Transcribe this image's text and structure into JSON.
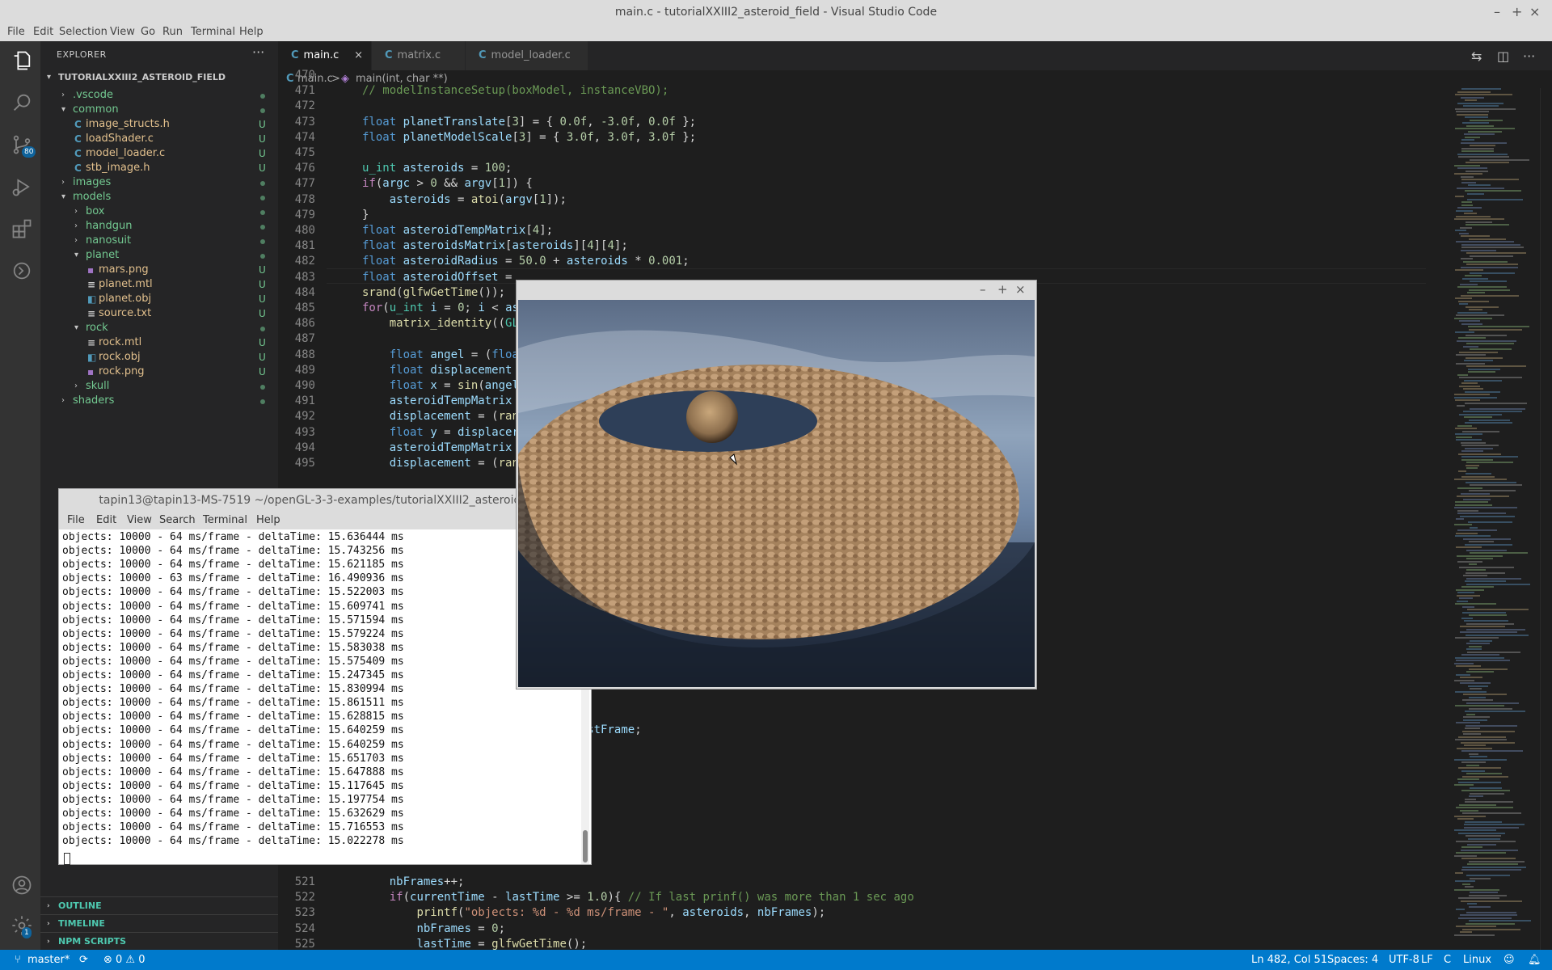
{
  "window": {
    "title": "main.c - tutorialXXIII2_asteroid_field - Visual Studio Code",
    "controls": [
      "–",
      "+",
      "×"
    ]
  },
  "menu": [
    "File",
    "Edit",
    "Selection",
    "View",
    "Go",
    "Run",
    "Terminal",
    "Help"
  ],
  "activity_bar": {
    "source_control_badge": "80",
    "settings_badge": "1",
    "icons": [
      "explorer-icon",
      "search-icon",
      "source-control-icon",
      "run-debug-icon",
      "extensions-icon",
      "remote-icon",
      "account-icon",
      "settings-gear-icon"
    ]
  },
  "sidebar": {
    "header": "EXPLORER",
    "more": "···",
    "root": "TUTORIALXXIII2_ASTEROID_FIELD",
    "tree": [
      {
        "label": ".vscode",
        "type": "folder",
        "depth": 1,
        "open": false,
        "status": "dot"
      },
      {
        "label": "common",
        "type": "folder",
        "depth": 1,
        "open": true,
        "status": "dot"
      },
      {
        "label": "image_structs.h",
        "type": "c",
        "depth": 2,
        "status": "U"
      },
      {
        "label": "loadShader.c",
        "type": "c",
        "depth": 2,
        "status": "U"
      },
      {
        "label": "model_loader.c",
        "type": "c",
        "depth": 2,
        "status": "U"
      },
      {
        "label": "stb_image.h",
        "type": "c",
        "depth": 2,
        "status": "U"
      },
      {
        "label": "images",
        "type": "folder",
        "depth": 1,
        "open": false,
        "status": "dot"
      },
      {
        "label": "models",
        "type": "folder",
        "depth": 1,
        "open": true,
        "status": "dot"
      },
      {
        "label": "box",
        "type": "folder",
        "depth": 2,
        "open": false,
        "status": "dot"
      },
      {
        "label": "handgun",
        "type": "folder",
        "depth": 2,
        "open": false,
        "status": "dot"
      },
      {
        "label": "nanosuit",
        "type": "folder",
        "depth": 2,
        "open": false,
        "status": "dot"
      },
      {
        "label": "planet",
        "type": "folder",
        "depth": 2,
        "open": true,
        "status": "dot"
      },
      {
        "label": "mars.png",
        "type": "img",
        "depth": 3,
        "status": "U"
      },
      {
        "label": "planet.mtl",
        "type": "txt",
        "depth": 3,
        "status": "U"
      },
      {
        "label": "planet.obj",
        "type": "obj",
        "depth": 3,
        "status": "U"
      },
      {
        "label": "source.txt",
        "type": "txt",
        "depth": 3,
        "status": "U"
      },
      {
        "label": "rock",
        "type": "folder",
        "depth": 2,
        "open": true,
        "status": "dot"
      },
      {
        "label": "rock.mtl",
        "type": "txt",
        "depth": 3,
        "status": "U"
      },
      {
        "label": "rock.obj",
        "type": "obj",
        "depth": 3,
        "status": "U"
      },
      {
        "label": "rock.png",
        "type": "img",
        "depth": 3,
        "status": "U"
      },
      {
        "label": "skull",
        "type": "folder",
        "depth": 2,
        "open": false,
        "status": "dot"
      },
      {
        "label": "shaders",
        "type": "folder",
        "depth": 1,
        "open": false,
        "status": "dot"
      }
    ],
    "sections": [
      "OUTLINE",
      "TIMELINE",
      "NPM SCRIPTS"
    ]
  },
  "tabs": [
    {
      "label": "main.c",
      "active": true,
      "close": "×"
    },
    {
      "label": "matrix.c",
      "active": false
    },
    {
      "label": "model_loader.c",
      "active": false
    }
  ],
  "breadcrumb": {
    "file": "main.c",
    "sep": ">",
    "symbol": "main(int, char **)"
  },
  "editor": {
    "lines": [
      {
        "n": "470",
        "html": ""
      },
      {
        "n": "471",
        "html": "<span class='cm'>// modelInstanceSetup(boxModel, instanceVBO);</span>"
      },
      {
        "n": "472",
        "html": ""
      },
      {
        "n": "473",
        "html": "<span class='k'>float</span> <span class='v'>planetTranslate</span>[<span class='n'>3</span>] = { <span class='n'>0.0f</span>, <span class='n'>-3.0f</span>, <span class='n'>0.0f</span> };"
      },
      {
        "n": "474",
        "html": "<span class='k'>float</span> <span class='v'>planetModelScale</span>[<span class='n'>3</span>] = { <span class='n'>3.0f</span>, <span class='n'>3.0f</span>, <span class='n'>3.0f</span> };"
      },
      {
        "n": "475",
        "html": ""
      },
      {
        "n": "476",
        "html": "<span class='t'>u_int</span> <span class='v'>asteroids</span> = <span class='n'>100</span>;"
      },
      {
        "n": "477",
        "html": "<span class='kc'>if</span>(<span class='v'>argc</span> &gt; <span class='n'>0</span> &amp;&amp; <span class='v'>argv</span>[<span class='n'>1</span>]) {"
      },
      {
        "n": "478",
        "html": "    <span class='v'>asteroids</span> = <span class='f'>atoi</span>(<span class='v'>argv</span>[<span class='n'>1</span>]);"
      },
      {
        "n": "479",
        "html": "}"
      },
      {
        "n": "480",
        "html": "<span class='k'>float</span> <span class='v'>asteroidTempMatrix</span>[<span class='n'>4</span>];"
      },
      {
        "n": "481",
        "html": "<span class='k'>float</span> <span class='v'>asteroidsMatrix</span>[<span class='v'>asteroids</span>][<span class='n'>4</span>][<span class='n'>4</span>];"
      },
      {
        "n": "482",
        "html": "<span class='k'>float</span> <span class='v'>asteroidRadius</span> = <span class='n'>50.0</span> + <span class='v'>asteroids</span> * <span class='n'>0.001</span>;"
      },
      {
        "n": "483",
        "html": "<span class='k'>float</span> <span class='v'>asteroidOffset</span> ="
      },
      {
        "n": "484",
        "html": "<span class='f'>srand</span>(<span class='f'>glfwGetTime</span>());"
      },
      {
        "n": "485",
        "html": "<span class='kc'>for</span>(<span class='t'>u_int</span> <span class='v'>i</span> = <span class='n'>0</span>; <span class='v'>i</span> &lt; <span class='v'>as</span>"
      },
      {
        "n": "486",
        "html": "    <span class='f'>matrix_identity</span>((<span class='t'>GL</span>"
      },
      {
        "n": "487",
        "html": ""
      },
      {
        "n": "488",
        "html": "    <span class='k'>float</span> <span class='v'>angel</span> = (<span class='k'>floa</span>"
      },
      {
        "n": "489",
        "html": "    <span class='k'>float</span> <span class='v'>displacement</span>"
      },
      {
        "n": "490",
        "html": "    <span class='k'>float</span> <span class='v'>x</span> = <span class='f'>sin</span>(<span class='v'>angel</span>"
      },
      {
        "n": "491",
        "html": "    <span class='v'>asteroidTempMatrix</span>"
      },
      {
        "n": "492",
        "html": "    <span class='v'>displacement</span> = (<span class='f'>ran</span>"
      },
      {
        "n": "493",
        "html": "    <span class='k'>float</span> <span class='v'>y</span> = <span class='v'>displacer</span>"
      },
      {
        "n": "494",
        "html": "    <span class='v'>asteroidTempMatrix</span>"
      },
      {
        "n": "495",
        "html": "    <span class='v'>displacement</span> = (<span class='f'>ran</span>"
      }
    ],
    "lower_lines": [
      {
        "n": "521",
        "html": "    <span class='v'>nbFrames</span>++;"
      },
      {
        "n": "522",
        "html": "    <span class='kc'>if</span>(<span class='v'>currentTime</span> - <span class='v'>lastTime</span> &gt;= <span class='n'>1.0</span>){ <span class='cm'>// If last prinf() was more than 1 sec ago</span>"
      },
      {
        "n": "523",
        "html": "        <span class='f'>printf</span>(<span class='s'>\"objects: %d - %d ms/frame - \"</span>, <span class='v'>asteroids</span>, <span class='v'>nbFrames</span>);"
      },
      {
        "n": "524",
        "html": "        <span class='v'>nbFrames</span> = <span class='n'>0</span>;"
      },
      {
        "n": "525",
        "html": "        <span class='v'>lastTime</span> = <span class='f'>glfwGetTime</span>();"
      }
    ],
    "partial_lines": [
      {
        "html": "<span class='faded'>    <span class='f'>matrix_rotate</span>((<span class='t'>GLfloat</span> *)<span class='v'>as</span></span><span class='v'>teroidsMatrix</span>[<span class='v'>i</span>], <span class='v'>rotateAngle</span>, (<span class='t'>GLfloat</span> *)<span class='v'>asteroidTempMatrix</span>);"
      },
      {
        "html": "<span class='faded'>    <span class='f'>glfwWindowShouldClose</span>(<span class='v'>windo</span></span><span class='v'>w</span>) == <span class='n'>0</span>) {"
      },
      {
        "html": "<span class='faded'>    <span class='f'>glfwPollEvents</span>();</span>"
      },
      {
        "html": "<span class='faded'>    <span class='v'>currentFrame</span> = <span class='f'>glfwGetTime</span>();</span>"
      },
      {
        "html": "<span class='faded'>    <span class='v'>currentTime</span> = <span class='f'>glfwGetTime</span>();</span>"
      },
      {
        "html": "<span class='faded'>    <span class='v'>deltaTime</span> = <span class='v'>currentFrame</span> - <span class='v'>la</span></span><span class='v'>stFrame</span>;"
      },
      {
        "html": "<span class='faded'>    <span class='v'>lastFrame</span> = <span class='v'>currentFrame</span>;</span>"
      }
    ]
  },
  "terminal": {
    "title": "tapin13@tapin13-MS-7519 ~/openGL-3-3-examples/tutorialXXIII2_asteroid_field",
    "menu": [
      "File",
      "Edit",
      "View",
      "Search",
      "Terminal",
      "Help"
    ],
    "lines": [
      "objects: 10000 - 64 ms/frame - deltaTime: 15.636444 ms",
      "objects: 10000 - 64 ms/frame - deltaTime: 15.743256 ms",
      "objects: 10000 - 64 ms/frame - deltaTime: 15.621185 ms",
      "objects: 10000 - 63 ms/frame - deltaTime: 16.490936 ms",
      "objects: 10000 - 64 ms/frame - deltaTime: 15.522003 ms",
      "objects: 10000 - 64 ms/frame - deltaTime: 15.609741 ms",
      "objects: 10000 - 64 ms/frame - deltaTime: 15.571594 ms",
      "objects: 10000 - 64 ms/frame - deltaTime: 15.579224 ms",
      "objects: 10000 - 64 ms/frame - deltaTime: 15.583038 ms",
      "objects: 10000 - 64 ms/frame - deltaTime: 15.575409 ms",
      "objects: 10000 - 64 ms/frame - deltaTime: 15.247345 ms",
      "objects: 10000 - 64 ms/frame - deltaTime: 15.830994 ms",
      "objects: 10000 - 64 ms/frame - deltaTime: 15.861511 ms",
      "objects: 10000 - 64 ms/frame - deltaTime: 15.628815 ms",
      "objects: 10000 - 64 ms/frame - deltaTime: 15.640259 ms",
      "objects: 10000 - 64 ms/frame - deltaTime: 15.640259 ms",
      "objects: 10000 - 64 ms/frame - deltaTime: 15.651703 ms",
      "objects: 10000 - 64 ms/frame - deltaTime: 15.647888 ms",
      "objects: 10000 - 64 ms/frame - deltaTime: 15.117645 ms",
      "objects: 10000 - 64 ms/frame - deltaTime: 15.197754 ms",
      "objects: 10000 - 64 ms/frame - deltaTime: 15.632629 ms",
      "objects: 10000 - 64 ms/frame - deltaTime: 15.716553 ms",
      "objects: 10000 - 64 ms/frame - deltaTime: 15.022278 ms"
    ]
  },
  "gl_window": {
    "controls": [
      "–",
      "+",
      "×"
    ]
  },
  "statusbar": {
    "branch": "master*",
    "errors": "⊗ 0 ⚠ 0",
    "position": "Ln 482, Col 51",
    "spaces": "Spaces: 4",
    "encoding": "UTF-8",
    "eol": "LF",
    "language": "C",
    "os": "Linux"
  },
  "colors": {
    "statusbar": "#007acc",
    "editor_bg": "#1e1e1e",
    "sidebar_bg": "#252526",
    "untracked": "#73c991",
    "modified": "#e2c08d"
  }
}
